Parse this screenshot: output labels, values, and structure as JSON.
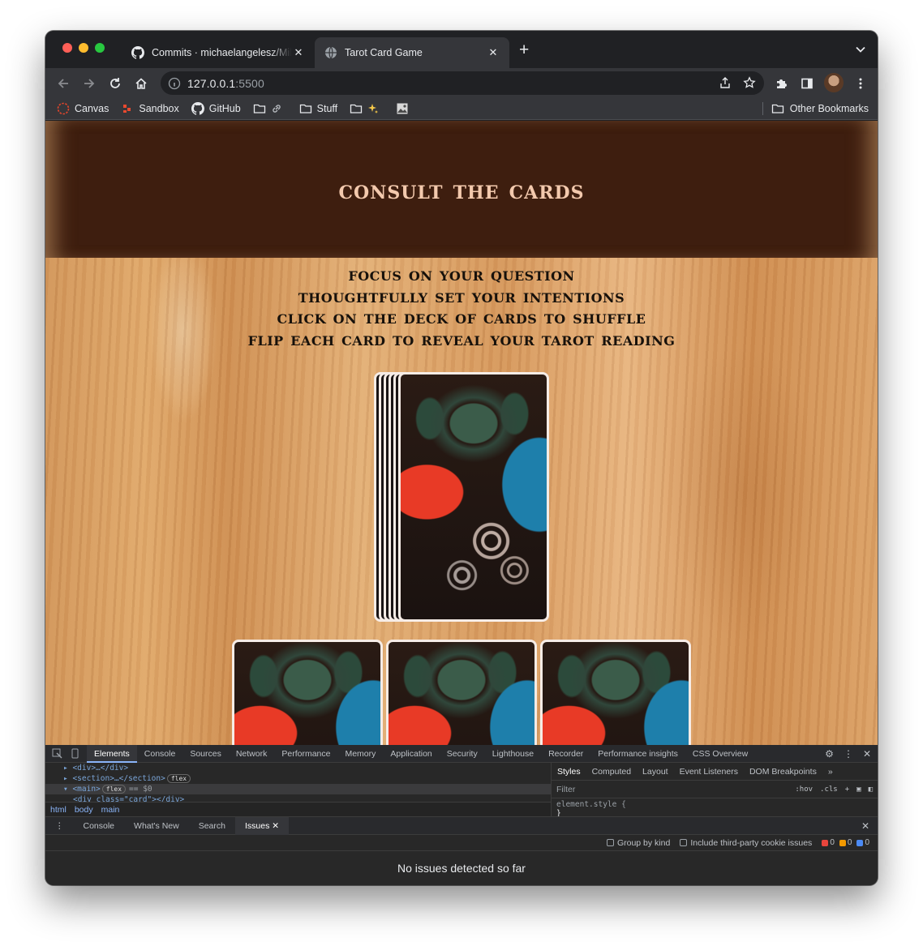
{
  "browser": {
    "tabs": [
      {
        "title": "Commits · michaelangelesz/Mil",
        "icon": "github-icon"
      },
      {
        "title": "Tarot Card Game",
        "icon": "globe-icon"
      }
    ],
    "url_host": "127.0.0.1",
    "url_port": ":5500",
    "bookmarks": [
      "Canvas",
      "Sandbox",
      "GitHub",
      "Stuff"
    ],
    "other_bookmarks": "Other Bookmarks"
  },
  "page": {
    "title": "Consult the Cards",
    "instructions": [
      "Focus on your question",
      "Thoughtfully set your intentions",
      "Click on the deck of cards to shuffle",
      "Flip each card to reveal your tarot reading"
    ]
  },
  "devtools": {
    "tabs": [
      "Elements",
      "Console",
      "Sources",
      "Network",
      "Performance",
      "Memory",
      "Application",
      "Security",
      "Lighthouse",
      "Recorder",
      "Performance insights",
      "CSS Overview"
    ],
    "dom_lines": [
      {
        "text": "<div>…</div>",
        "selected": false
      },
      {
        "text": "<section>…</section>",
        "pill": "flex",
        "selected": false
      },
      {
        "text": "<main>",
        "pill": "flex",
        "eq": "== $0",
        "selected": true
      },
      {
        "text": "<div class=\"card\"></div>",
        "selected": false
      }
    ],
    "breadcrumbs": [
      "html",
      "body",
      "main"
    ],
    "style_tabs": [
      "Styles",
      "Computed",
      "Layout",
      "Event Listeners",
      "DOM Breakpoints",
      "»"
    ],
    "filter_placeholder": "Filter",
    "filter_tools": [
      ":hov",
      ".cls",
      "+"
    ],
    "element_style": "element.style {",
    "element_style_close": "}",
    "drawer_tabs": [
      "Console",
      "What's New",
      "Search",
      "Issues"
    ],
    "group_by_kind": "Group by kind",
    "third_party": "Include third-party cookie issues",
    "counts": {
      "errors": "0",
      "warnings": "0",
      "info": "0"
    },
    "no_issues": "No issues detected so far"
  },
  "colors": {
    "header_bg": "#3e1e0f",
    "title_color": "#f3c9ad",
    "wood": "#dca468"
  }
}
